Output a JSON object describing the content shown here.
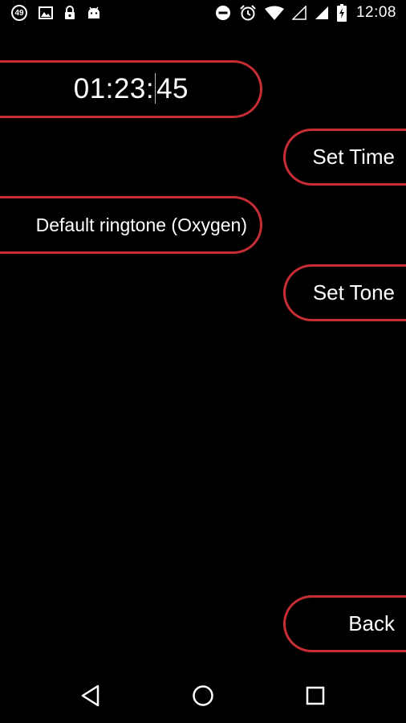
{
  "status_bar": {
    "notification_count": "49",
    "time": "12:08",
    "left_icons": [
      "notification-count-icon",
      "image-icon",
      "lock-icon",
      "android-icon"
    ],
    "right_icons": [
      "do-not-disturb-icon",
      "alarm-clock-icon",
      "wifi-icon",
      "signal-empty-icon",
      "signal-full-icon",
      "battery-charging-icon"
    ]
  },
  "timer": {
    "value_before_caret": "01:23:",
    "value_after_caret": "45"
  },
  "buttons": {
    "set_time": "Set Time",
    "set_tone": "Set Tone",
    "back": "Back"
  },
  "ringtone": {
    "value": "Default ringtone (Oxygen)"
  },
  "nav_bar": {
    "icons": [
      "back-triangle-icon",
      "home-circle-icon",
      "recents-square-icon"
    ]
  },
  "colors": {
    "background": "#000000",
    "accent_border": "#c62d35",
    "text": "#ffffff"
  }
}
